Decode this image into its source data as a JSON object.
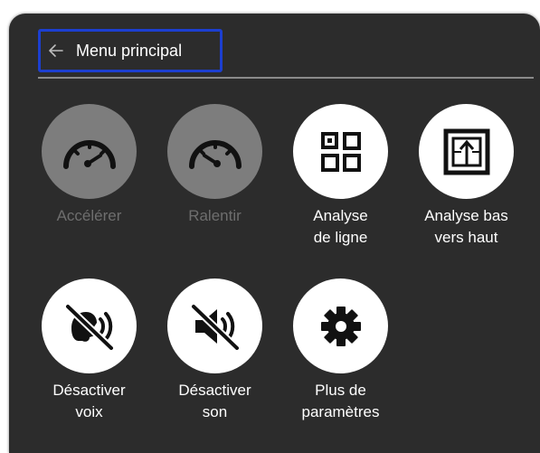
{
  "header": {
    "back_icon": "arrow-left-icon",
    "title": "Menu principal"
  },
  "tiles": [
    {
      "label": "Accélérer",
      "icon": "speedometer-fast-icon",
      "enabled": false
    },
    {
      "label": "Ralentir",
      "icon": "speedometer-slow-icon",
      "enabled": false
    },
    {
      "label": "Analyse\nde ligne",
      "icon": "row-scan-icon",
      "enabled": true
    },
    {
      "label": "Analyse bas\nvers haut",
      "icon": "bottom-up-scan-icon",
      "enabled": true
    },
    {
      "label": "Désactiver\nvoix",
      "icon": "voice-off-icon",
      "enabled": true
    },
    {
      "label": "Désactiver\nson",
      "icon": "sound-off-icon",
      "enabled": true
    },
    {
      "label": "Plus de\nparamètres",
      "icon": "gear-icon",
      "enabled": true
    }
  ],
  "colors": {
    "panel_bg": "#2c2c2c",
    "focus_outline": "#1c3fd0",
    "disabled_circle": "#7d7d7d",
    "disabled_text": "#6e6e6e",
    "enabled_circle": "#ffffff"
  }
}
